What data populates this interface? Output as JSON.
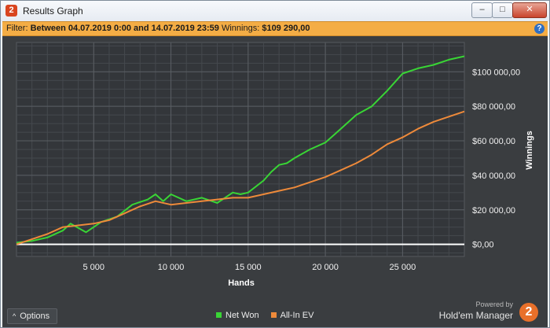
{
  "window": {
    "title": "Results Graph",
    "app_icon": "hold-em-manager-2-icon",
    "controls": [
      "minimize-icon",
      "maximize-icon",
      "close-icon"
    ]
  },
  "filter": {
    "label": "Filter:",
    "value": "Between 04.07.2019 0:00 and 14.07.2019 23:59",
    "winnings_label": "Winnings:",
    "winnings_value": "$109 290,00",
    "help_icon": "help-icon"
  },
  "footer": {
    "options_label": "Options",
    "powered_by": "Powered by",
    "brand": "Hold'em Manager",
    "brand_mark": "2"
  },
  "colors": {
    "net_won": "#39d535",
    "all_in_ev": "#ee8a3a",
    "background": "#3a3d40",
    "zero_line": "#ffffff"
  },
  "chart_data": {
    "type": "line",
    "title": "",
    "xlabel": "Hands",
    "ylabel": "Winnings",
    "xlim": [
      0,
      29000
    ],
    "ylim": [
      -7000,
      117000
    ],
    "x_ticks": [
      5000,
      10000,
      15000,
      20000,
      25000
    ],
    "x_tick_labels": [
      "5 000",
      "10 000",
      "15 000",
      "20 000",
      "25 000"
    ],
    "y_ticks": [
      0,
      20000,
      40000,
      60000,
      80000,
      100000
    ],
    "y_tick_labels": [
      "$0,00",
      "$20 000,00",
      "$40 000,00",
      "$60 000,00",
      "$80 000,00",
      "$100 000,00"
    ],
    "grid": true,
    "legend_position": "bottom",
    "series": [
      {
        "name": "Net Won",
        "x": [
          0,
          1000,
          2000,
          3000,
          3500,
          4500,
          5500,
          6500,
          7500,
          8500,
          9000,
          9500,
          10000,
          11000,
          12000,
          13000,
          14000,
          14500,
          15000,
          16000,
          16500,
          17000,
          17500,
          18000,
          19000,
          20000,
          21000,
          22000,
          23000,
          24000,
          25000,
          26000,
          27000,
          28000,
          29000
        ],
        "y": [
          1000,
          2000,
          4000,
          8000,
          12000,
          7000,
          13000,
          16000,
          23000,
          26000,
          29000,
          25000,
          29000,
          25000,
          27000,
          24000,
          30000,
          29000,
          30000,
          37000,
          42000,
          46000,
          47000,
          50000,
          55000,
          59000,
          67000,
          75000,
          80000,
          89000,
          99000,
          102000,
          104000,
          107000,
          109000
        ]
      },
      {
        "name": "All-In EV",
        "x": [
          0,
          1000,
          2000,
          3000,
          4000,
          5000,
          6000,
          7000,
          8000,
          9000,
          10000,
          11000,
          12000,
          13000,
          14000,
          15000,
          16000,
          17000,
          18000,
          19000,
          20000,
          21000,
          22000,
          23000,
          24000,
          25000,
          26000,
          27000,
          28000,
          29000
        ],
        "y": [
          0,
          3000,
          6000,
          10000,
          11000,
          12000,
          14000,
          18000,
          22000,
          25000,
          23000,
          24000,
          25000,
          26000,
          27000,
          27000,
          29000,
          31000,
          33000,
          36000,
          39000,
          43000,
          47000,
          52000,
          58000,
          62000,
          67000,
          71000,
          74000,
          77000
        ]
      }
    ]
  }
}
